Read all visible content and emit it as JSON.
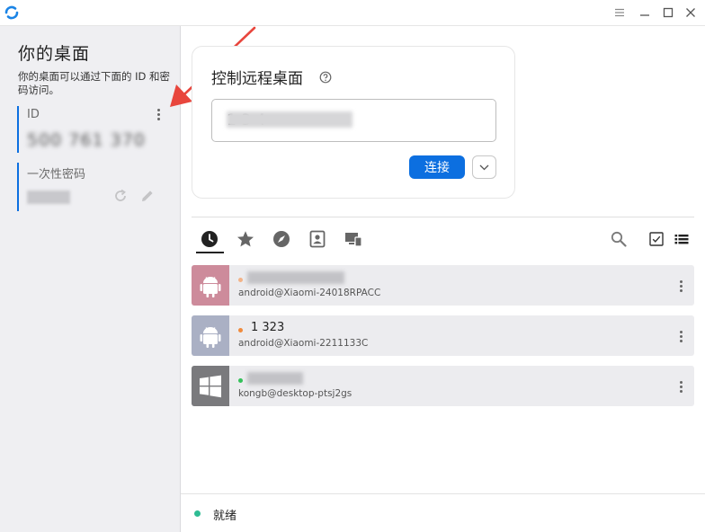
{
  "sidebar": {
    "title": "你的桌面",
    "description": "你的桌面可以通过下面的 ID 和密码访问。",
    "id_label": "ID",
    "id_value": "500 761 370",
    "password_label": "一次性密码"
  },
  "connect": {
    "title": "控制远程桌面",
    "input_value": "1 3 4",
    "connect_label": "连接"
  },
  "peers": [
    {
      "name": "",
      "subtitle": "android@Xiaomi-24018RPACC",
      "os": "android",
      "thumb_color": "#cd8b9b",
      "status_color": "#f3b388"
    },
    {
      "name": "1 323",
      "subtitle": "android@Xiaomi-2211133C",
      "os": "android",
      "thumb_color": "#aab0c4",
      "status_color": "#f08a3c"
    },
    {
      "name": "",
      "subtitle": "kongb@desktop-ptsj2gs",
      "os": "windows",
      "thumb_color": "#7a7a7d",
      "status_color": "#34c15a"
    }
  ],
  "status": {
    "text": "就绪"
  },
  "colors": {
    "accent": "#0c6fe0",
    "ready": "#2ebc93"
  }
}
